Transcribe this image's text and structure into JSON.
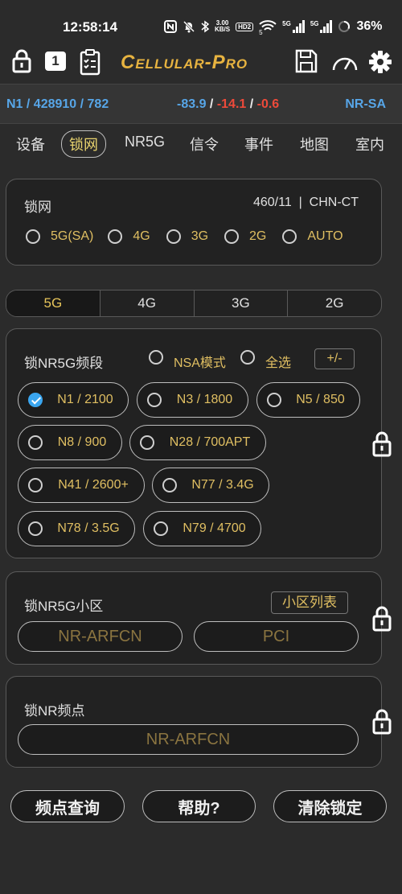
{
  "status": {
    "time": "12:58:14",
    "speed_value": "3.00",
    "speed_unit": "KB/S",
    "hd": "HD2",
    "wifi_sub": "5",
    "sig1": "5G",
    "sig2": "5G",
    "battery": "36%"
  },
  "toolbar": {
    "title": "Cellular-Pro",
    "badge": "1"
  },
  "info": {
    "cell": "N1 / 428910 / 782",
    "rsrp": "-83.9",
    "rsrq": "-14.1",
    "sinr": "-0.6",
    "sep": " / ",
    "mode": "NR-SA"
  },
  "nav": {
    "tabs": [
      "设备",
      "锁网",
      "NR5G",
      "信令",
      "事件",
      "地图",
      "室内"
    ],
    "active": 1
  },
  "lock_net": {
    "title": "锁网",
    "operator": "460/11  |  CHN-CT",
    "options": [
      "5G(SA)",
      "4G",
      "3G",
      "2G",
      "AUTO"
    ]
  },
  "rat_tabs": {
    "items": [
      "5G",
      "4G",
      "3G",
      "2G"
    ],
    "active": 0
  },
  "band_lock": {
    "title": "锁NR5G频段",
    "nsa_label": "NSA模式",
    "all_label": "全选",
    "plusminus": "+/-",
    "bands": [
      {
        "label": "N1 / 2100",
        "checked": true
      },
      {
        "label": "N3 / 1800",
        "checked": false
      },
      {
        "label": "N5 / 850",
        "checked": false
      },
      {
        "label": "N8 / 900",
        "checked": false
      },
      {
        "label": "N28 / 700APT",
        "checked": false
      },
      {
        "label": "N41 / 2600+",
        "checked": false
      },
      {
        "label": "N77 / 3.4G",
        "checked": false
      },
      {
        "label": "N78 / 3.5G",
        "checked": false
      },
      {
        "label": "N79 / 4700",
        "checked": false
      }
    ]
  },
  "cell_lock": {
    "title": "锁NR5G小区",
    "list_button": "小区列表",
    "arfcn_placeholder": "NR-ARFCN",
    "pci_placeholder": "PCI"
  },
  "freq_lock": {
    "title": "锁NR频点",
    "arfcn_placeholder": "NR-ARFCN"
  },
  "bottom": {
    "query": "频点查询",
    "help": "帮助?",
    "clear": "清除锁定"
  }
}
